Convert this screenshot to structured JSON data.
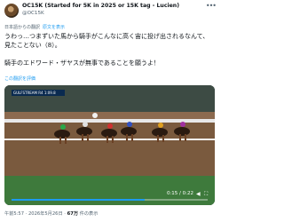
{
  "post": {
    "display_name": "OC15K (Started for 5K in 2025 or 15K tag - Lucien)",
    "handle": "@OC15K",
    "translate_note": "日本語からの翻訳",
    "translate_note_link": "原文を表示",
    "text_line1": "うわっ…つまずいた馬から騎手がこんなに高く宙に投げ出されるなんて、見たことない（8）。",
    "text_line2": "騎手のエドワード・ザヤスが無事であることを願うよ！",
    "translate_link": "この翻訳を評価",
    "video_time": "0:15 / 0:22",
    "scoreboard_text": "GULFSTREAM R4 1:09.8",
    "meta_time": "午前5:57 · 2026年5月26日 · ",
    "meta_views": "67万",
    "meta_views_suffix": " 件の表示"
  },
  "icons": {
    "more": "more-dots-icon",
    "mute": "volume-icon",
    "fullscreen": "fullscreen-icon"
  },
  "colors": {
    "link": "#1d9bf0",
    "muted": "#536471",
    "text": "#0f1419"
  }
}
